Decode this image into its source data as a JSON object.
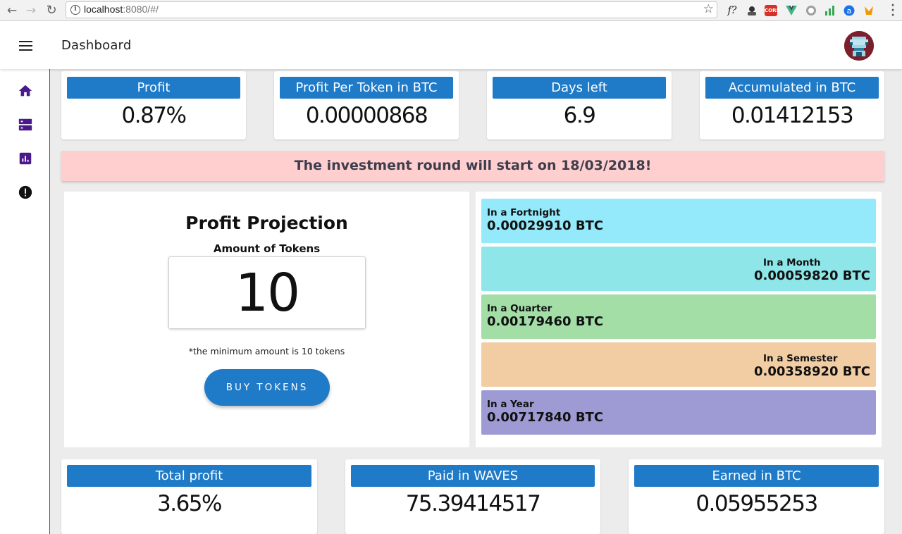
{
  "browser": {
    "url_host": "localhost",
    "url_rest": ":8080/#/"
  },
  "header": {
    "title": "Dashboard"
  },
  "top_stats": [
    {
      "label": "Profit",
      "value": "0.87%"
    },
    {
      "label": "Profit Per Token in BTC",
      "value": "0.00000868"
    },
    {
      "label": "Days left",
      "value": "6.9"
    },
    {
      "label": "Accumulated in BTC",
      "value": "0.01412153"
    }
  ],
  "banner": {
    "text": "The investment round will start on 18/03/2018!"
  },
  "projection": {
    "title": "Profit Projection",
    "amount_label": "Amount of Tokens",
    "amount_value": "10",
    "min_note": "*the minimum amount is 10 tokens",
    "buy_label": "BUY TOKENS"
  },
  "periods": [
    {
      "label": "In a Fortnight",
      "value": "0.00029910 BTC",
      "color": "#94eafa"
    },
    {
      "label": "In a Month",
      "value": "0.00059820 BTC",
      "color": "#8ee6e8"
    },
    {
      "label": "In a Quarter",
      "value": "0.00179460 BTC",
      "color": "#a2dea6"
    },
    {
      "label": "In a Semester",
      "value": "0.00358920 BTC",
      "color": "#f2cda4"
    },
    {
      "label": "In a Year",
      "value": "0.00717840 BTC",
      "color": "#9d9ad4"
    }
  ],
  "bottom_stats": [
    {
      "label": "Total profit",
      "value": "3.65%"
    },
    {
      "label": "Paid in WAVES",
      "value": "75.39414517"
    },
    {
      "label": "Earned in BTC",
      "value": "0.05955253"
    }
  ],
  "colors": {
    "primary": "#1f7ac7",
    "sidebar_icon": "#4a1a8a",
    "banner_bg": "#ffcfd0"
  },
  "icons": {
    "sidebar": [
      "home-icon",
      "storage-icon",
      "chart-icon",
      "alert-icon"
    ]
  }
}
